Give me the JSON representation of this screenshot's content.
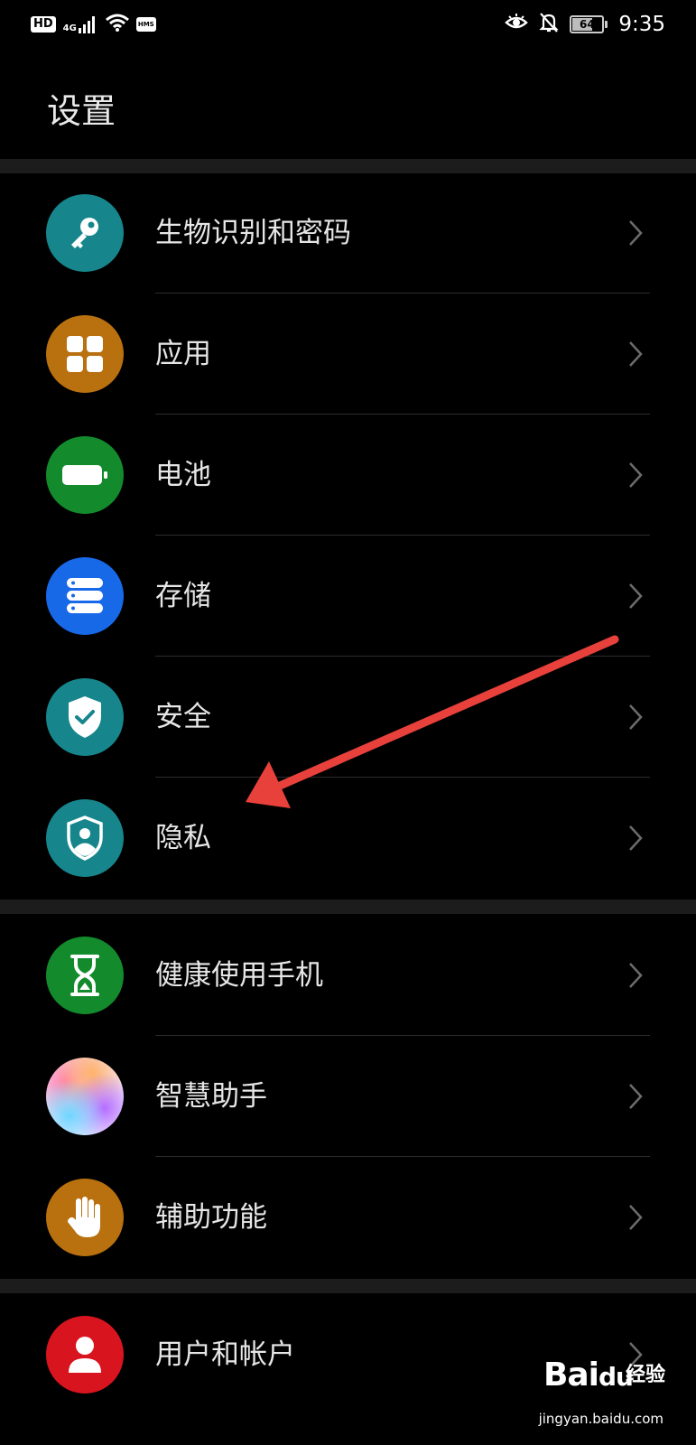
{
  "status_bar": {
    "hd": "HD",
    "network": "4G",
    "hms": "HMS",
    "battery_level": "64",
    "time": "9:35"
  },
  "page": {
    "title": "设置"
  },
  "groups": [
    [
      {
        "label": "生物识别和密码",
        "icon": "key-icon",
        "color": "#16868c"
      },
      {
        "label": "应用",
        "icon": "apps-grid-icon",
        "color": "#b9700f"
      },
      {
        "label": "电池",
        "icon": "battery-icon",
        "color": "#138b2c"
      },
      {
        "label": "存储",
        "icon": "storage-icon",
        "color": "#1769e8"
      },
      {
        "label": "安全",
        "icon": "shield-check-icon",
        "color": "#16868c"
      },
      {
        "label": "隐私",
        "icon": "privacy-shield-icon",
        "color": "#16868c"
      }
    ],
    [
      {
        "label": "健康使用手机",
        "icon": "hourglass-icon",
        "color": "#138b2c"
      },
      {
        "label": "智慧助手",
        "icon": "assistant-orb-icon",
        "color": "gradient"
      },
      {
        "label": "辅助功能",
        "icon": "hand-icon",
        "color": "#b9700f"
      }
    ],
    [
      {
        "label": "用户和帐户",
        "icon": "user-icon",
        "color": "#d8141e"
      }
    ]
  ],
  "annotation": {
    "arrow_color": "#e8413b"
  },
  "watermark": {
    "brand": "Bai",
    "brand_suffix": "du",
    "name": "经验",
    "url": "jingyan.baidu.com"
  }
}
